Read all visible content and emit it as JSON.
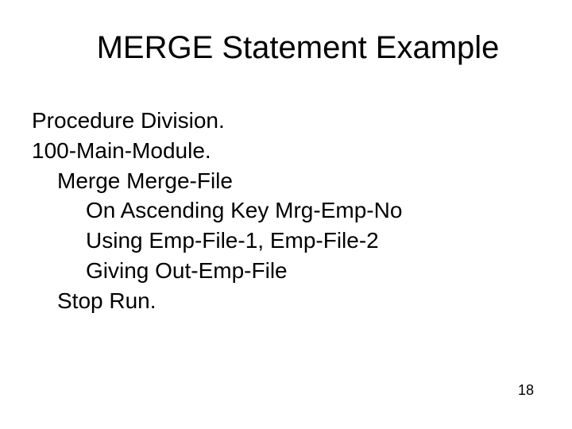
{
  "title": "MERGE Statement Example",
  "lines": [
    "Procedure Division.",
    "100-Main-Module.",
    "Merge Merge-File",
    "On Ascending Key Mrg-Emp-No",
    "Using Emp-File-1, Emp-File-2",
    "Giving Out-Emp-File",
    "Stop Run."
  ],
  "page_number": "18"
}
